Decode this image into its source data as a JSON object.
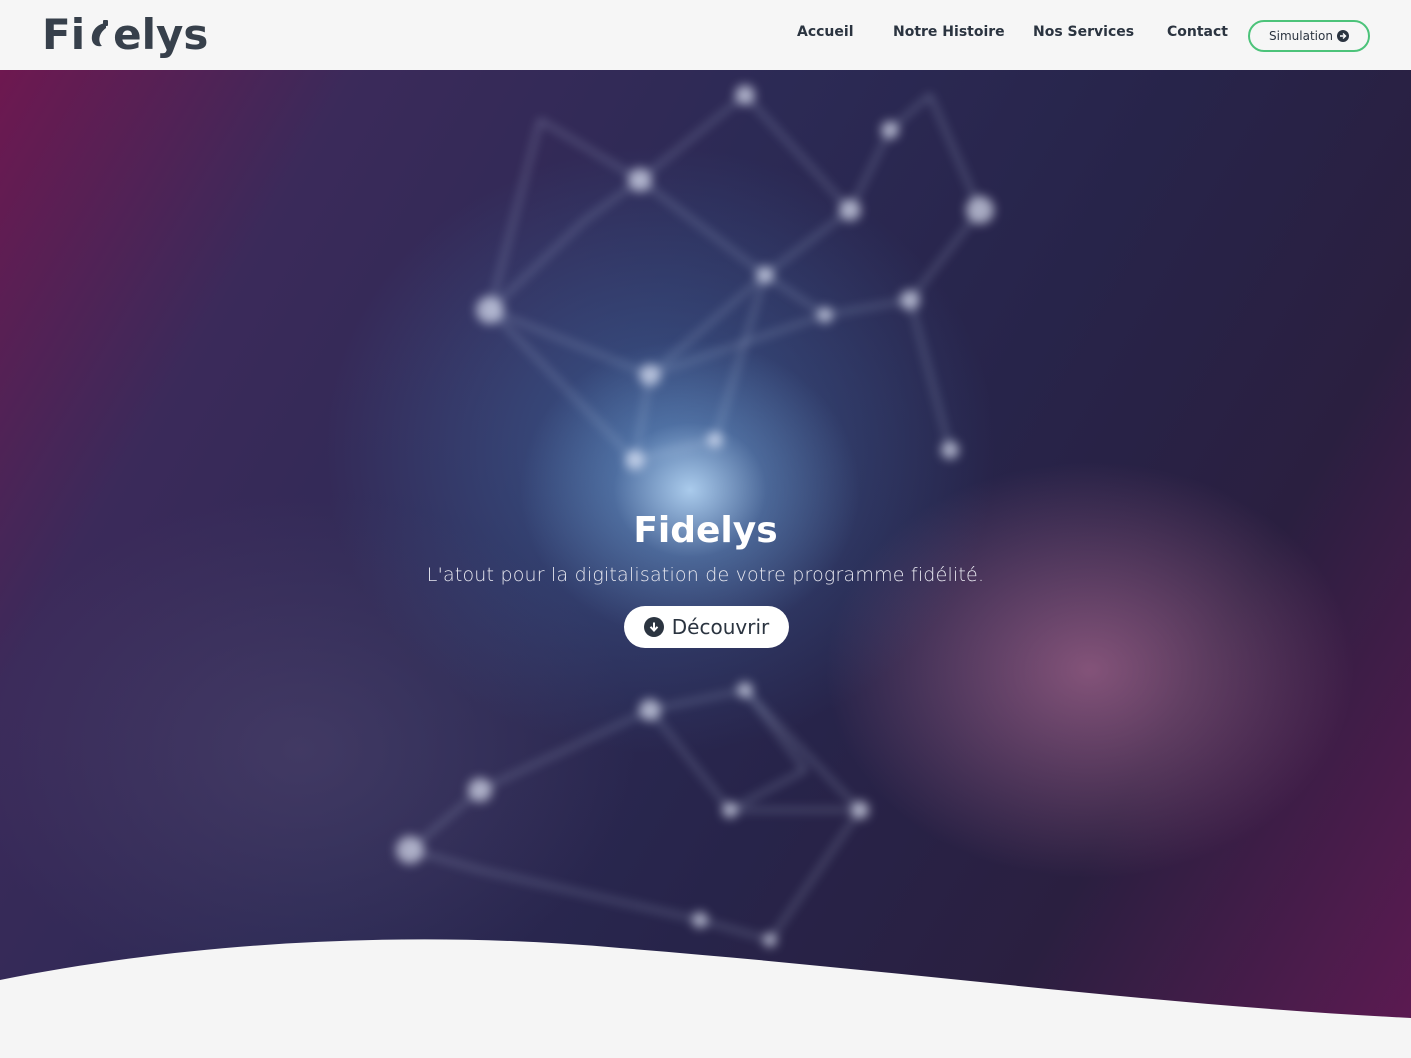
{
  "brand": {
    "name": "Fidelys",
    "logo_left": "Fi",
    "logo_right": "elys"
  },
  "nav": {
    "items": [
      {
        "label": "Accueil"
      },
      {
        "label": "Notre Histoire"
      },
      {
        "label": "Nos Services"
      },
      {
        "label": "Contact"
      }
    ],
    "simulation_label": "Simulation",
    "simulation_icon": "circle-arrow-right-icon"
  },
  "hero": {
    "title": "Fidelys",
    "subtitle": "L'atout pour la digitalisation de votre programme fidélité.",
    "cta_label": "Découvrir",
    "cta_icon": "circle-arrow-down-icon"
  },
  "colors": {
    "accent_green": "#4cc37a",
    "text_dark": "#2b3440",
    "hero_purple": "#2c2a55",
    "hero_magenta": "#6e1850"
  }
}
